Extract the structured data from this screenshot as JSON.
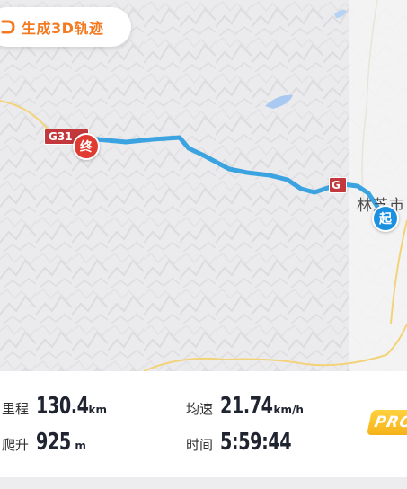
{
  "toolbar": {
    "generate_3d_label": "生成3D轨迹",
    "icon": "3d-track-icon",
    "accent": "#f47a21"
  },
  "map": {
    "road_labels": [
      "G31",
      "G"
    ],
    "city_label": "林芝市",
    "markers": {
      "end_label": "终",
      "start_label": "起",
      "end_color": "#e03b32",
      "start_color": "#1b8fe0"
    },
    "route_color": "#3aa3e0"
  },
  "stats": {
    "distance": {
      "label": "里程",
      "value": "130.4",
      "unit": "km"
    },
    "climb": {
      "label": "爬升",
      "value": "925",
      "unit": "m"
    },
    "avg_speed": {
      "label": "均速",
      "value": "21.74",
      "unit": "km/h"
    },
    "duration": {
      "label": "时间",
      "value": "5:59:44"
    }
  },
  "badge": {
    "label": "PRO"
  }
}
